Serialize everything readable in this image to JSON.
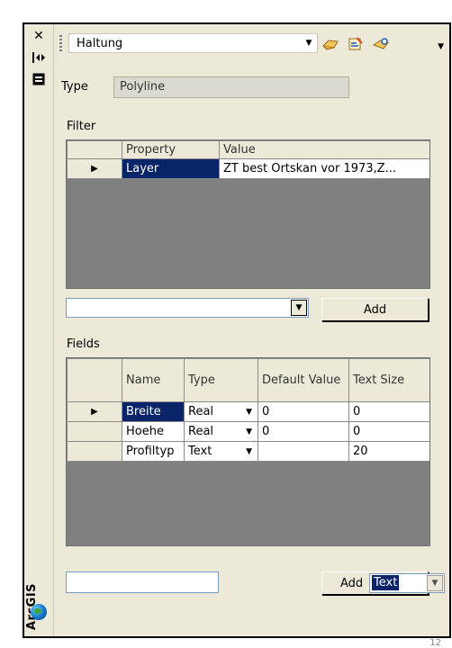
{
  "toolbar": {
    "layer_combo_value": "Haltung"
  },
  "side": {
    "close_glyph": "✕",
    "autohide_glyph": "|◂▸",
    "arcgis_label": "ArcGIS"
  },
  "type_section": {
    "label": "Type",
    "value": "Polyline"
  },
  "filter": {
    "label": "Filter",
    "columns": [
      "Property",
      "Value"
    ],
    "rows": [
      {
        "property": "Layer",
        "value": "ZT best Ortskan vor 1973,Z..."
      }
    ],
    "add_label": "Add",
    "combo_value": ""
  },
  "fields": {
    "label": "Fields",
    "columns": [
      "Name",
      "Type",
      "Default Value",
      "Text Size"
    ],
    "rows": [
      {
        "name": "Breite",
        "type": "Real",
        "default": "0",
        "size": "0"
      },
      {
        "name": "Hoehe",
        "type": "Real",
        "default": "0",
        "size": "0"
      },
      {
        "name": "Profiltyp",
        "type": "Text",
        "default": "",
        "size": "20"
      }
    ],
    "add_label": "Add",
    "type_combo_value": "Text",
    "name_input_value": ""
  },
  "page_number": "12",
  "colors": {
    "panel_bg": "#ece9d8",
    "selection": "#0a246a",
    "grid_bg": "#808080"
  },
  "icons": [
    "close-icon",
    "autohide-icon",
    "panel-icon",
    "globe-icon",
    "tool-icon-1",
    "tool-icon-2",
    "tool-icon-3"
  ]
}
